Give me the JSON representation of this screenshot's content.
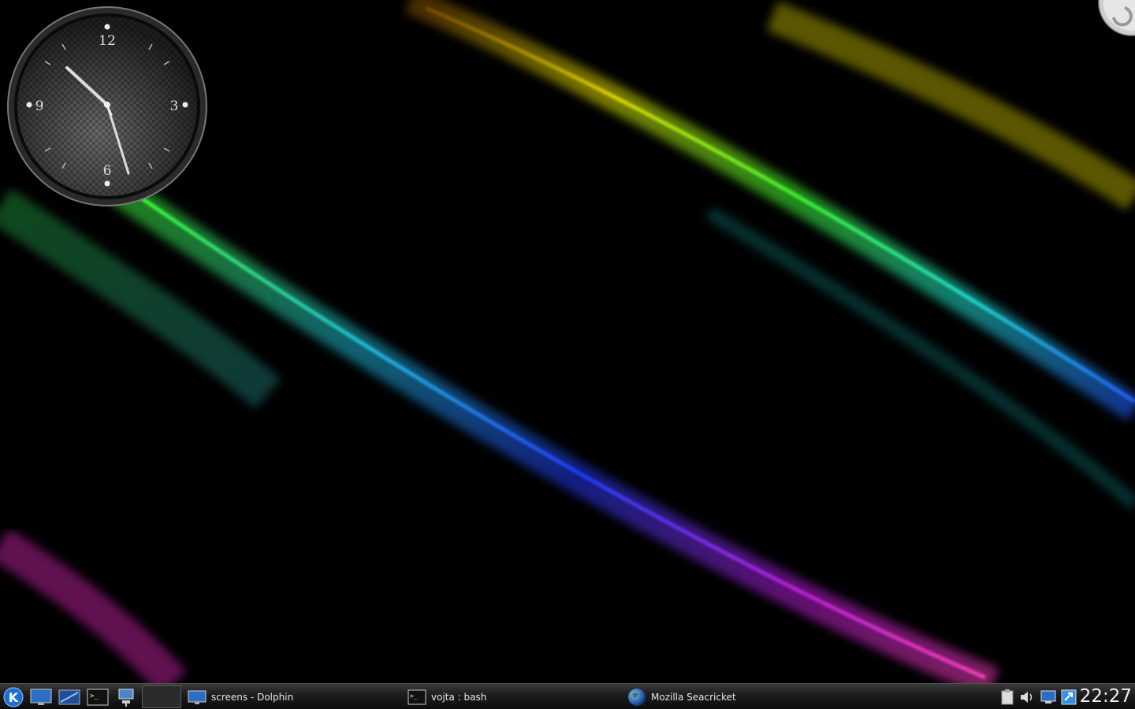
{
  "desktop": {
    "clock": {
      "hour_labels": [
        "12",
        "3",
        "6",
        "9"
      ]
    }
  },
  "panel": {
    "launchers": [
      {
        "icon": "kde-menu-icon"
      },
      {
        "icon": "show-desktop-icon"
      },
      {
        "icon": "dolphin-launcher-icon"
      },
      {
        "icon": "terminal-launcher-icon"
      },
      {
        "icon": "network-launcher-icon"
      }
    ],
    "tasks": [
      {
        "label": "screens - Dolphin",
        "icon": "dolphin-window-icon"
      },
      {
        "label": "vojta : bash",
        "icon": "terminal-window-icon"
      },
      {
        "label": "Mozilla Seacricket",
        "icon": "globe-icon"
      }
    ],
    "tray": [
      {
        "icon": "clipboard-icon"
      },
      {
        "icon": "volume-icon"
      },
      {
        "icon": "network-monitor-icon"
      },
      {
        "icon": "updates-icon"
      }
    ],
    "clock_time": "22:27"
  },
  "colors": {
    "panel_text": "#e8e8e8",
    "kde_blue": "#1a6fd1"
  }
}
